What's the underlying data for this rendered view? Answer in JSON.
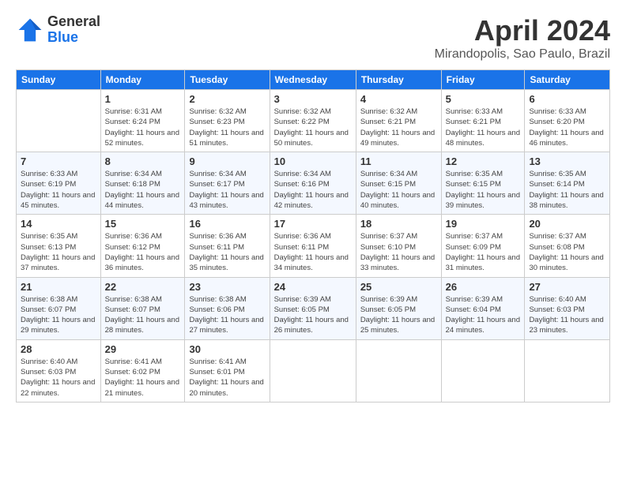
{
  "logo": {
    "general": "General",
    "blue": "Blue"
  },
  "title": "April 2024",
  "location": "Mirandopolis, Sao Paulo, Brazil",
  "days_of_week": [
    "Sunday",
    "Monday",
    "Tuesday",
    "Wednesday",
    "Thursday",
    "Friday",
    "Saturday"
  ],
  "weeks": [
    [
      {
        "day": "",
        "sunrise": "",
        "sunset": "",
        "daylight": ""
      },
      {
        "day": "1",
        "sunrise": "Sunrise: 6:31 AM",
        "sunset": "Sunset: 6:24 PM",
        "daylight": "Daylight: 11 hours and 52 minutes."
      },
      {
        "day": "2",
        "sunrise": "Sunrise: 6:32 AM",
        "sunset": "Sunset: 6:23 PM",
        "daylight": "Daylight: 11 hours and 51 minutes."
      },
      {
        "day": "3",
        "sunrise": "Sunrise: 6:32 AM",
        "sunset": "Sunset: 6:22 PM",
        "daylight": "Daylight: 11 hours and 50 minutes."
      },
      {
        "day": "4",
        "sunrise": "Sunrise: 6:32 AM",
        "sunset": "Sunset: 6:21 PM",
        "daylight": "Daylight: 11 hours and 49 minutes."
      },
      {
        "day": "5",
        "sunrise": "Sunrise: 6:33 AM",
        "sunset": "Sunset: 6:21 PM",
        "daylight": "Daylight: 11 hours and 48 minutes."
      },
      {
        "day": "6",
        "sunrise": "Sunrise: 6:33 AM",
        "sunset": "Sunset: 6:20 PM",
        "daylight": "Daylight: 11 hours and 46 minutes."
      }
    ],
    [
      {
        "day": "7",
        "sunrise": "Sunrise: 6:33 AM",
        "sunset": "Sunset: 6:19 PM",
        "daylight": "Daylight: 11 hours and 45 minutes."
      },
      {
        "day": "8",
        "sunrise": "Sunrise: 6:34 AM",
        "sunset": "Sunset: 6:18 PM",
        "daylight": "Daylight: 11 hours and 44 minutes."
      },
      {
        "day": "9",
        "sunrise": "Sunrise: 6:34 AM",
        "sunset": "Sunset: 6:17 PM",
        "daylight": "Daylight: 11 hours and 43 minutes."
      },
      {
        "day": "10",
        "sunrise": "Sunrise: 6:34 AM",
        "sunset": "Sunset: 6:16 PM",
        "daylight": "Daylight: 11 hours and 42 minutes."
      },
      {
        "day": "11",
        "sunrise": "Sunrise: 6:34 AM",
        "sunset": "Sunset: 6:15 PM",
        "daylight": "Daylight: 11 hours and 40 minutes."
      },
      {
        "day": "12",
        "sunrise": "Sunrise: 6:35 AM",
        "sunset": "Sunset: 6:15 PM",
        "daylight": "Daylight: 11 hours and 39 minutes."
      },
      {
        "day": "13",
        "sunrise": "Sunrise: 6:35 AM",
        "sunset": "Sunset: 6:14 PM",
        "daylight": "Daylight: 11 hours and 38 minutes."
      }
    ],
    [
      {
        "day": "14",
        "sunrise": "Sunrise: 6:35 AM",
        "sunset": "Sunset: 6:13 PM",
        "daylight": "Daylight: 11 hours and 37 minutes."
      },
      {
        "day": "15",
        "sunrise": "Sunrise: 6:36 AM",
        "sunset": "Sunset: 6:12 PM",
        "daylight": "Daylight: 11 hours and 36 minutes."
      },
      {
        "day": "16",
        "sunrise": "Sunrise: 6:36 AM",
        "sunset": "Sunset: 6:11 PM",
        "daylight": "Daylight: 11 hours and 35 minutes."
      },
      {
        "day": "17",
        "sunrise": "Sunrise: 6:36 AM",
        "sunset": "Sunset: 6:11 PM",
        "daylight": "Daylight: 11 hours and 34 minutes."
      },
      {
        "day": "18",
        "sunrise": "Sunrise: 6:37 AM",
        "sunset": "Sunset: 6:10 PM",
        "daylight": "Daylight: 11 hours and 33 minutes."
      },
      {
        "day": "19",
        "sunrise": "Sunrise: 6:37 AM",
        "sunset": "Sunset: 6:09 PM",
        "daylight": "Daylight: 11 hours and 31 minutes."
      },
      {
        "day": "20",
        "sunrise": "Sunrise: 6:37 AM",
        "sunset": "Sunset: 6:08 PM",
        "daylight": "Daylight: 11 hours and 30 minutes."
      }
    ],
    [
      {
        "day": "21",
        "sunrise": "Sunrise: 6:38 AM",
        "sunset": "Sunset: 6:07 PM",
        "daylight": "Daylight: 11 hours and 29 minutes."
      },
      {
        "day": "22",
        "sunrise": "Sunrise: 6:38 AM",
        "sunset": "Sunset: 6:07 PM",
        "daylight": "Daylight: 11 hours and 28 minutes."
      },
      {
        "day": "23",
        "sunrise": "Sunrise: 6:38 AM",
        "sunset": "Sunset: 6:06 PM",
        "daylight": "Daylight: 11 hours and 27 minutes."
      },
      {
        "day": "24",
        "sunrise": "Sunrise: 6:39 AM",
        "sunset": "Sunset: 6:05 PM",
        "daylight": "Daylight: 11 hours and 26 minutes."
      },
      {
        "day": "25",
        "sunrise": "Sunrise: 6:39 AM",
        "sunset": "Sunset: 6:05 PM",
        "daylight": "Daylight: 11 hours and 25 minutes."
      },
      {
        "day": "26",
        "sunrise": "Sunrise: 6:39 AM",
        "sunset": "Sunset: 6:04 PM",
        "daylight": "Daylight: 11 hours and 24 minutes."
      },
      {
        "day": "27",
        "sunrise": "Sunrise: 6:40 AM",
        "sunset": "Sunset: 6:03 PM",
        "daylight": "Daylight: 11 hours and 23 minutes."
      }
    ],
    [
      {
        "day": "28",
        "sunrise": "Sunrise: 6:40 AM",
        "sunset": "Sunset: 6:03 PM",
        "daylight": "Daylight: 11 hours and 22 minutes."
      },
      {
        "day": "29",
        "sunrise": "Sunrise: 6:41 AM",
        "sunset": "Sunset: 6:02 PM",
        "daylight": "Daylight: 11 hours and 21 minutes."
      },
      {
        "day": "30",
        "sunrise": "Sunrise: 6:41 AM",
        "sunset": "Sunset: 6:01 PM",
        "daylight": "Daylight: 11 hours and 20 minutes."
      },
      {
        "day": "",
        "sunrise": "",
        "sunset": "",
        "daylight": ""
      },
      {
        "day": "",
        "sunrise": "",
        "sunset": "",
        "daylight": ""
      },
      {
        "day": "",
        "sunrise": "",
        "sunset": "",
        "daylight": ""
      },
      {
        "day": "",
        "sunrise": "",
        "sunset": "",
        "daylight": ""
      }
    ]
  ]
}
